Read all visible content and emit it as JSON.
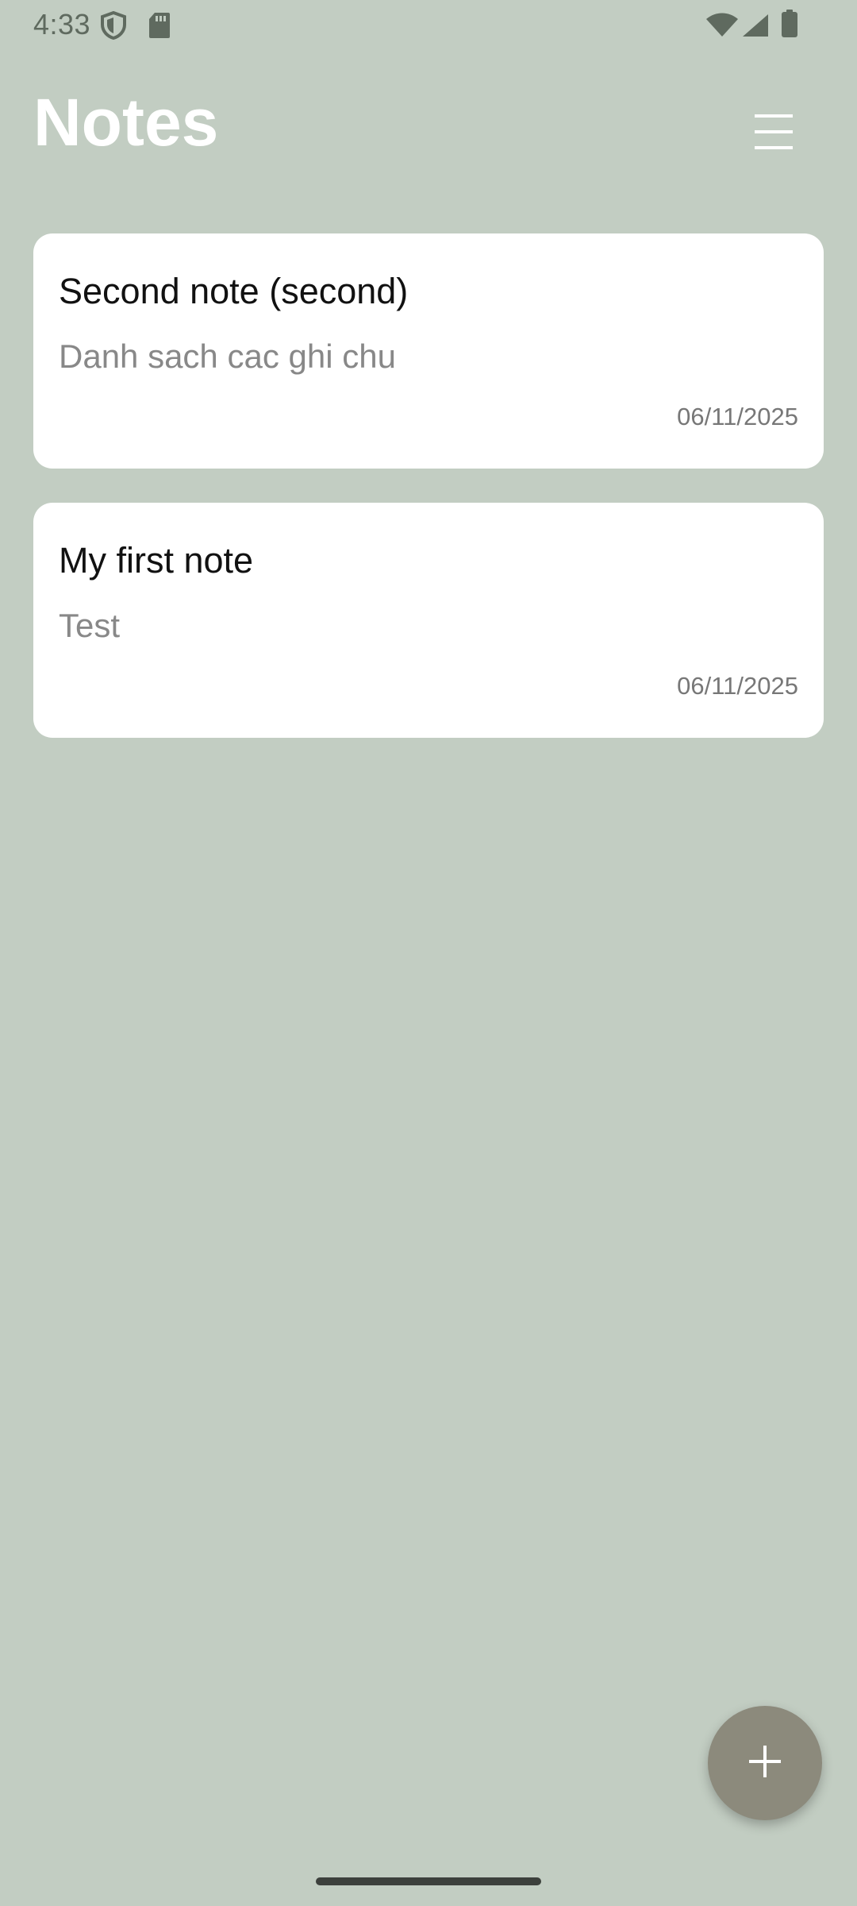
{
  "status_bar": {
    "time": "4:33",
    "icons": [
      "shield-icon",
      "sdcard-icon",
      "wifi-icon",
      "signal-icon",
      "battery-icon"
    ]
  },
  "header": {
    "title": "Notes",
    "menu_icon": "hamburger-menu-icon"
  },
  "notes": [
    {
      "title": "Second note (second)",
      "body": "Danh sach cac ghi chu",
      "date": "06/11/2025"
    },
    {
      "title": "My first note",
      "body": "Test",
      "date": "06/11/2025"
    }
  ],
  "fab": {
    "icon": "plus-icon"
  },
  "colors": {
    "background": "#c2cdc2",
    "card": "#ffffff",
    "title_text": "#ffffff",
    "fab": "#8c8a7c"
  }
}
